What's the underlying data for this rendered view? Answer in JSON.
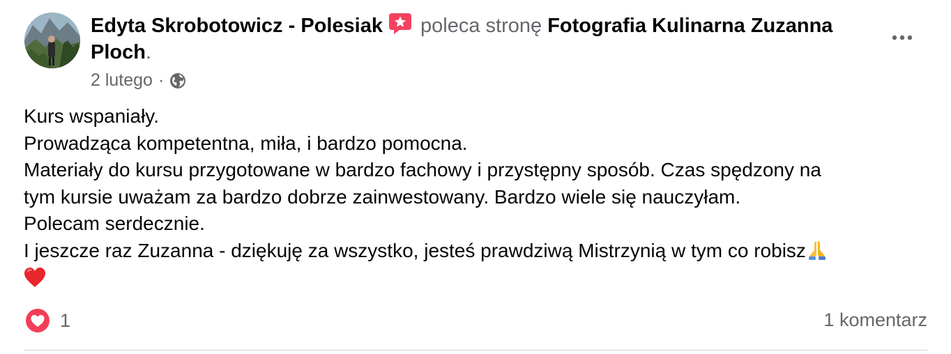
{
  "post": {
    "author": "Edyta Skrobotowicz - Polesiak",
    "recommend_text": "poleca stronę",
    "page_name": "Fotografia Kulinarna Zuzanna Ploch",
    "period": ".",
    "date": "2 lutego",
    "separator": "·",
    "privacy_icon": "globe-icon",
    "recommend_icon": "recommend-star-icon",
    "body_lines": [
      "Kurs wspaniały.",
      "Prowadząca kompetentna, miła, i bardzo pomocna.",
      "Materiały do kursu przygotowane w bardzo fachowy i przystępny sposób. Czas spędzony na",
      "tym kursie uważam za bardzo dobrze zainwestowany. Bardzo wiele się nauczyłam.",
      "Polecam serdecznie.",
      "I jeszcze raz Zuzanna - dziękuję za wszystko, jesteś prawdziwą Mistrzynią w tym co robisz"
    ],
    "body_emojis": [
      "folded-hands-emoji",
      "red-heart-emoji"
    ],
    "reaction_icon": "love-reaction-icon",
    "reaction_count": "1",
    "comment_count": "1 komentarz"
  },
  "colors": {
    "primary_text": "#050505",
    "secondary_text": "#65676b",
    "love_red": "#f33e58",
    "divider": "#ced0d4"
  }
}
